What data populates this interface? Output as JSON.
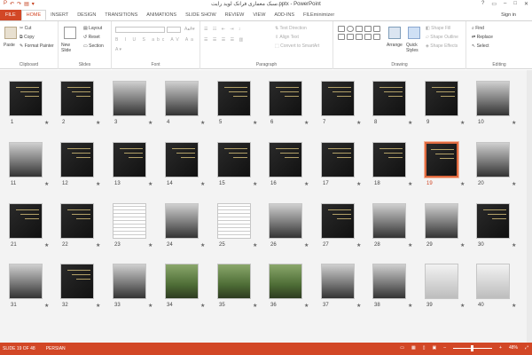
{
  "titlebar": {
    "qat": [
      "P",
      "↶",
      "↷",
      "▤",
      "▾"
    ],
    "title": "سبک معماری فرانک لوید رایت.pptx - PowerPoint",
    "controls": [
      "?",
      "▭",
      "–",
      "□",
      "✕"
    ]
  },
  "tabs": [
    "FILE",
    "HOME",
    "INSERT",
    "DESIGN",
    "TRANSITIONS",
    "ANIMATIONS",
    "SLIDE SHOW",
    "REVIEW",
    "VIEW",
    "ADD-INS",
    "FILEminimizer"
  ],
  "signin": "Sign in",
  "ribbon": {
    "clipboard": {
      "label": "Clipboard",
      "paste": "Paste",
      "cut": "Cut",
      "copy": "Copy",
      "format_painter": "Format Painter"
    },
    "slides": {
      "label": "Slides",
      "new_slide": "New Slide",
      "layout": "Layout",
      "reset": "Reset",
      "section": "Section"
    },
    "font": {
      "label": "Font"
    },
    "paragraph": {
      "label": "Paragraph",
      "text_direction": "Text Direction",
      "align_text": "Align Text",
      "convert": "Convert to SmartArt"
    },
    "drawing": {
      "label": "Drawing",
      "arrange": "Arrange",
      "quick_styles": "Quick Styles",
      "shape_fill": "Shape Fill",
      "shape_outline": "Shape Outline",
      "shape_effects": "Shape Effects"
    },
    "editing": {
      "label": "Editing",
      "find": "Find",
      "replace": "Replace",
      "select": "Select"
    }
  },
  "slides": [
    {
      "n": "1",
      "style": "dark"
    },
    {
      "n": "2",
      "style": "dark"
    },
    {
      "n": "3",
      "style": "photo"
    },
    {
      "n": "4",
      "style": "photo"
    },
    {
      "n": "5",
      "style": "dark"
    },
    {
      "n": "6",
      "style": "dark"
    },
    {
      "n": "7",
      "style": "dark"
    },
    {
      "n": "8",
      "style": "dark"
    },
    {
      "n": "9",
      "style": "dark"
    },
    {
      "n": "10",
      "style": "photo"
    },
    {
      "n": "11",
      "style": "photo"
    },
    {
      "n": "12",
      "style": "dark"
    },
    {
      "n": "13",
      "style": "dark"
    },
    {
      "n": "14",
      "style": "dark"
    },
    {
      "n": "15",
      "style": "dark"
    },
    {
      "n": "16",
      "style": "dark"
    },
    {
      "n": "17",
      "style": "dark"
    },
    {
      "n": "18",
      "style": "dark"
    },
    {
      "n": "19",
      "style": "dark"
    },
    {
      "n": "20",
      "style": "photo"
    },
    {
      "n": "21",
      "style": "dark"
    },
    {
      "n": "22",
      "style": "dark"
    },
    {
      "n": "23",
      "style": "plan"
    },
    {
      "n": "24",
      "style": "photo"
    },
    {
      "n": "25",
      "style": "plan"
    },
    {
      "n": "26",
      "style": "photo"
    },
    {
      "n": "27",
      "style": "dark"
    },
    {
      "n": "28",
      "style": "photo"
    },
    {
      "n": "29",
      "style": "photo"
    },
    {
      "n": "30",
      "style": "dark"
    },
    {
      "n": "31",
      "style": "photo"
    },
    {
      "n": "32",
      "style": "dark"
    },
    {
      "n": "33",
      "style": "photo"
    },
    {
      "n": "34",
      "style": "green"
    },
    {
      "n": "35",
      "style": "green"
    },
    {
      "n": "36",
      "style": "green"
    },
    {
      "n": "37",
      "style": "photo"
    },
    {
      "n": "38",
      "style": "photo"
    },
    {
      "n": "39",
      "style": "light"
    },
    {
      "n": "40",
      "style": "light"
    }
  ],
  "selected_slide": "19",
  "status": {
    "slide": "SLIDE 19 OF 48",
    "lang": "PERSIAN",
    "zoom": "48%"
  },
  "colors": {
    "accent": "#d24726"
  }
}
